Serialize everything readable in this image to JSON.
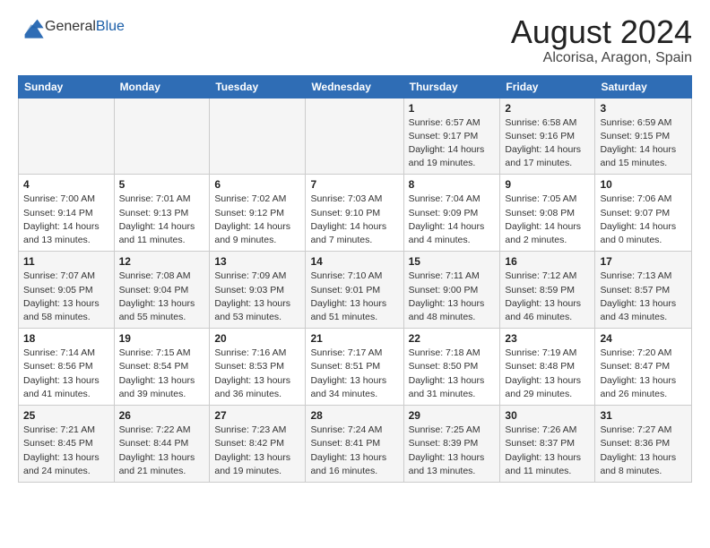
{
  "header": {
    "logo_general": "General",
    "logo_blue": "Blue",
    "main_title": "August 2024",
    "sub_title": "Alcorisa, Aragon, Spain"
  },
  "weekdays": [
    "Sunday",
    "Monday",
    "Tuesday",
    "Wednesday",
    "Thursday",
    "Friday",
    "Saturday"
  ],
  "weeks": [
    [
      {
        "day": "",
        "info": ""
      },
      {
        "day": "",
        "info": ""
      },
      {
        "day": "",
        "info": ""
      },
      {
        "day": "",
        "info": ""
      },
      {
        "day": "1",
        "info": "Sunrise: 6:57 AM\nSunset: 9:17 PM\nDaylight: 14 hours\nand 19 minutes."
      },
      {
        "day": "2",
        "info": "Sunrise: 6:58 AM\nSunset: 9:16 PM\nDaylight: 14 hours\nand 17 minutes."
      },
      {
        "day": "3",
        "info": "Sunrise: 6:59 AM\nSunset: 9:15 PM\nDaylight: 14 hours\nand 15 minutes."
      }
    ],
    [
      {
        "day": "4",
        "info": "Sunrise: 7:00 AM\nSunset: 9:14 PM\nDaylight: 14 hours\nand 13 minutes."
      },
      {
        "day": "5",
        "info": "Sunrise: 7:01 AM\nSunset: 9:13 PM\nDaylight: 14 hours\nand 11 minutes."
      },
      {
        "day": "6",
        "info": "Sunrise: 7:02 AM\nSunset: 9:12 PM\nDaylight: 14 hours\nand 9 minutes."
      },
      {
        "day": "7",
        "info": "Sunrise: 7:03 AM\nSunset: 9:10 PM\nDaylight: 14 hours\nand 7 minutes."
      },
      {
        "day": "8",
        "info": "Sunrise: 7:04 AM\nSunset: 9:09 PM\nDaylight: 14 hours\nand 4 minutes."
      },
      {
        "day": "9",
        "info": "Sunrise: 7:05 AM\nSunset: 9:08 PM\nDaylight: 14 hours\nand 2 minutes."
      },
      {
        "day": "10",
        "info": "Sunrise: 7:06 AM\nSunset: 9:07 PM\nDaylight: 14 hours\nand 0 minutes."
      }
    ],
    [
      {
        "day": "11",
        "info": "Sunrise: 7:07 AM\nSunset: 9:05 PM\nDaylight: 13 hours\nand 58 minutes."
      },
      {
        "day": "12",
        "info": "Sunrise: 7:08 AM\nSunset: 9:04 PM\nDaylight: 13 hours\nand 55 minutes."
      },
      {
        "day": "13",
        "info": "Sunrise: 7:09 AM\nSunset: 9:03 PM\nDaylight: 13 hours\nand 53 minutes."
      },
      {
        "day": "14",
        "info": "Sunrise: 7:10 AM\nSunset: 9:01 PM\nDaylight: 13 hours\nand 51 minutes."
      },
      {
        "day": "15",
        "info": "Sunrise: 7:11 AM\nSunset: 9:00 PM\nDaylight: 13 hours\nand 48 minutes."
      },
      {
        "day": "16",
        "info": "Sunrise: 7:12 AM\nSunset: 8:59 PM\nDaylight: 13 hours\nand 46 minutes."
      },
      {
        "day": "17",
        "info": "Sunrise: 7:13 AM\nSunset: 8:57 PM\nDaylight: 13 hours\nand 43 minutes."
      }
    ],
    [
      {
        "day": "18",
        "info": "Sunrise: 7:14 AM\nSunset: 8:56 PM\nDaylight: 13 hours\nand 41 minutes."
      },
      {
        "day": "19",
        "info": "Sunrise: 7:15 AM\nSunset: 8:54 PM\nDaylight: 13 hours\nand 39 minutes."
      },
      {
        "day": "20",
        "info": "Sunrise: 7:16 AM\nSunset: 8:53 PM\nDaylight: 13 hours\nand 36 minutes."
      },
      {
        "day": "21",
        "info": "Sunrise: 7:17 AM\nSunset: 8:51 PM\nDaylight: 13 hours\nand 34 minutes."
      },
      {
        "day": "22",
        "info": "Sunrise: 7:18 AM\nSunset: 8:50 PM\nDaylight: 13 hours\nand 31 minutes."
      },
      {
        "day": "23",
        "info": "Sunrise: 7:19 AM\nSunset: 8:48 PM\nDaylight: 13 hours\nand 29 minutes."
      },
      {
        "day": "24",
        "info": "Sunrise: 7:20 AM\nSunset: 8:47 PM\nDaylight: 13 hours\nand 26 minutes."
      }
    ],
    [
      {
        "day": "25",
        "info": "Sunrise: 7:21 AM\nSunset: 8:45 PM\nDaylight: 13 hours\nand 24 minutes."
      },
      {
        "day": "26",
        "info": "Sunrise: 7:22 AM\nSunset: 8:44 PM\nDaylight: 13 hours\nand 21 minutes."
      },
      {
        "day": "27",
        "info": "Sunrise: 7:23 AM\nSunset: 8:42 PM\nDaylight: 13 hours\nand 19 minutes."
      },
      {
        "day": "28",
        "info": "Sunrise: 7:24 AM\nSunset: 8:41 PM\nDaylight: 13 hours\nand 16 minutes."
      },
      {
        "day": "29",
        "info": "Sunrise: 7:25 AM\nSunset: 8:39 PM\nDaylight: 13 hours\nand 13 minutes."
      },
      {
        "day": "30",
        "info": "Sunrise: 7:26 AM\nSunset: 8:37 PM\nDaylight: 13 hours\nand 11 minutes."
      },
      {
        "day": "31",
        "info": "Sunrise: 7:27 AM\nSunset: 8:36 PM\nDaylight: 13 hours\nand 8 minutes."
      }
    ]
  ]
}
